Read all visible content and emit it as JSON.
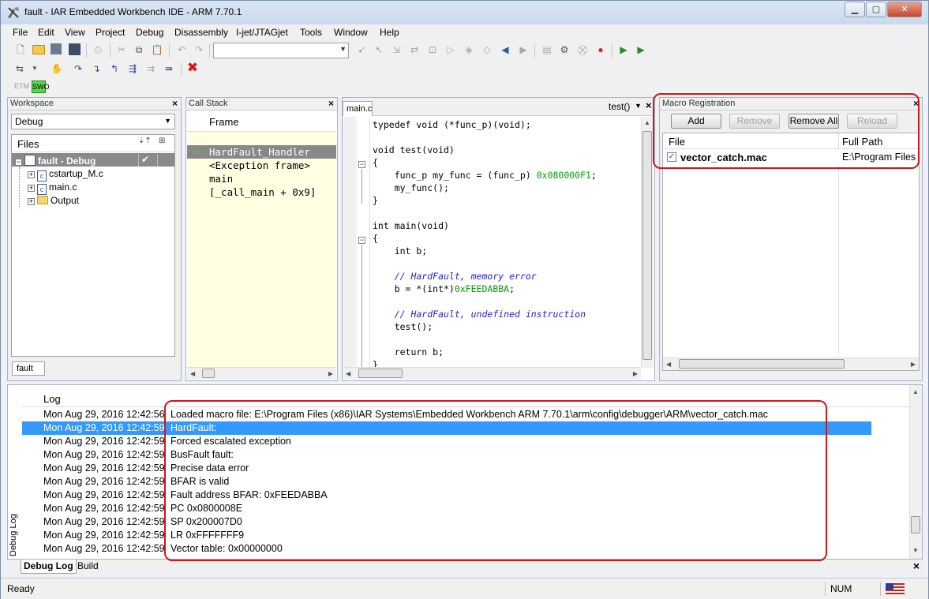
{
  "window": {
    "title": "fault - IAR Embedded Workbench IDE - ARM 7.70.1",
    "min": "▁",
    "max": "▢",
    "close": "✕"
  },
  "menu": [
    "File",
    "Edit",
    "View",
    "Project",
    "Debug",
    "Disassembly",
    "I-jet/JTAGjet",
    "Tools",
    "Window",
    "Help"
  ],
  "toolbar": {
    "etm_label": "ETM",
    "swo_label": "SWO",
    "combo_value": ""
  },
  "workspace": {
    "title": "Workspace",
    "config": "Debug",
    "files_header": "Files",
    "tab_label": "fault",
    "tree": [
      {
        "label": "fault - Debug",
        "check": "✔",
        "bold": true
      },
      {
        "label": "cstartup_M.c"
      },
      {
        "label": "main.c"
      },
      {
        "label": "Output"
      }
    ]
  },
  "callstack": {
    "title": "Call Stack",
    "frame_header": "Frame",
    "frames": [
      "HardFault_Handler",
      "<Exception frame>",
      "main",
      "[_call_main + 0x9]"
    ]
  },
  "editor": {
    "tab": "main.c",
    "function_combo": "test()",
    "lines": [
      [
        {
          "t": "typedef void (*func_p)(void);"
        }
      ],
      [
        {
          "t": ""
        }
      ],
      [
        {
          "t": "void test(void)"
        }
      ],
      [
        {
          "t": "{"
        }
      ],
      [
        {
          "t": "    func_p my_func = (func_p) "
        },
        {
          "t": "0x080000F1",
          "c": "num"
        },
        {
          "t": ";"
        }
      ],
      [
        {
          "t": "    my_func();"
        }
      ],
      [
        {
          "t": "}"
        }
      ],
      [
        {
          "t": ""
        }
      ],
      [
        {
          "t": "int main(void)"
        }
      ],
      [
        {
          "t": "{"
        }
      ],
      [
        {
          "t": "    int b;"
        }
      ],
      [
        {
          "t": ""
        }
      ],
      [
        {
          "t": "    // HardFault, memory error",
          "c": "com"
        }
      ],
      [
        {
          "t": "    b = *(int*)"
        },
        {
          "t": "0xFEEDABBA",
          "c": "num"
        },
        {
          "t": ";"
        }
      ],
      [
        {
          "t": ""
        }
      ],
      [
        {
          "t": "    // HardFault, undefined instruction",
          "c": "com"
        }
      ],
      [
        {
          "t": "    test();"
        }
      ],
      [
        {
          "t": ""
        }
      ],
      [
        {
          "t": "    return b;"
        }
      ],
      [
        {
          "t": "}"
        }
      ]
    ]
  },
  "macro": {
    "title": "Macro Registration",
    "buttons": {
      "add": "Add",
      "remove": "Remove",
      "remove_all": "Remove All",
      "reload": "Reload"
    },
    "col_file": "File",
    "col_path": "Full Path",
    "rows": [
      {
        "file": "vector_catch.mac",
        "path": "E:\\Program Files",
        "checked": "✓"
      }
    ]
  },
  "log": {
    "header": "Log",
    "side_label": "Debug Log",
    "rows": [
      {
        "ts": "Mon Aug 29, 2016 12:42:56",
        "msg": "Loaded macro file: E:\\Program Files (x86)\\IAR Systems\\Embedded Workbench ARM 7.70.1\\arm\\config\\debugger\\ARM\\vector_catch.mac"
      },
      {
        "ts": "Mon Aug 29, 2016 12:42:59",
        "msg": "HardFault:"
      },
      {
        "ts": "Mon Aug 29, 2016 12:42:59",
        "msg": "Forced escalated exception"
      },
      {
        "ts": "Mon Aug 29, 2016 12:42:59",
        "msg": "BusFault fault:"
      },
      {
        "ts": "Mon Aug 29, 2016 12:42:59",
        "msg": "Precise data error"
      },
      {
        "ts": "Mon Aug 29, 2016 12:42:59",
        "msg": "BFAR is valid"
      },
      {
        "ts": "Mon Aug 29, 2016 12:42:59",
        "msg": "Fault address BFAR: 0xFEEDABBA"
      },
      {
        "ts": "Mon Aug 29, 2016 12:42:59",
        "msg": "PC 0x0800008E"
      },
      {
        "ts": "Mon Aug 29, 2016 12:42:59",
        "msg": "SP 0x200007D0"
      },
      {
        "ts": "Mon Aug 29, 2016 12:42:59",
        "msg": "LR 0xFFFFFFF9"
      },
      {
        "ts": "Mon Aug 29, 2016 12:42:59",
        "msg": "Vector table: 0x00000000"
      }
    ],
    "tabs": [
      "Debug Log",
      "Build"
    ]
  },
  "status": {
    "text": "Ready",
    "num": "NUM"
  },
  "colors": {
    "highlight": "#3399ff",
    "annotation": "#d2161a",
    "code_number": "#00a000",
    "code_comment": "#2424d0"
  }
}
